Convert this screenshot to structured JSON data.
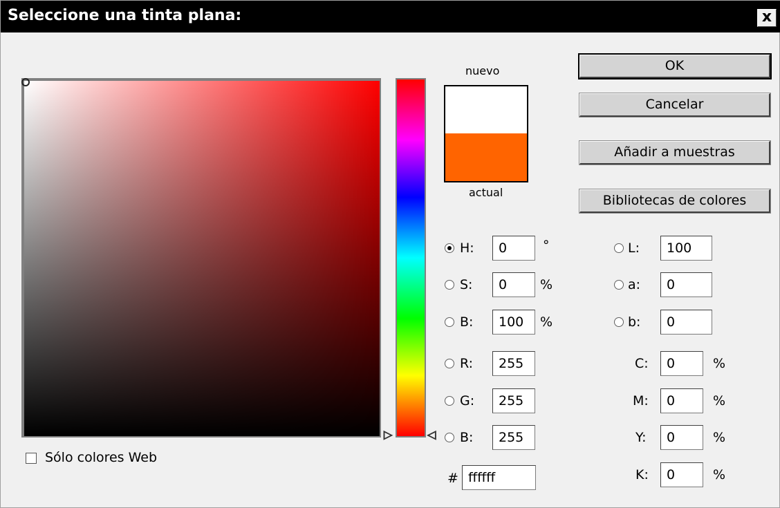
{
  "dialog": {
    "title": "Seleccione una tinta plana:",
    "close_label": "x"
  },
  "colors": {
    "nuevo": "#ffffff",
    "actual": "#ff6400",
    "hue_field_base": "#ff0000"
  },
  "swatch": {
    "new_label": "nuevo",
    "current_label": "actual"
  },
  "buttons": {
    "ok": "OK",
    "cancel": "Cancelar",
    "add_to_swatches": "Añadir a muestras",
    "color_libraries": "Bibliotecas de colores"
  },
  "hsb": {
    "h": {
      "label": "H:",
      "value": "0",
      "unit": "°",
      "selected": true
    },
    "s": {
      "label": "S:",
      "value": "0",
      "unit": "%"
    },
    "b": {
      "label": "B:",
      "value": "100",
      "unit": "%"
    }
  },
  "rgb": {
    "r": {
      "label": "R:",
      "value": "255"
    },
    "g": {
      "label": "G:",
      "value": "255"
    },
    "b": {
      "label": "B:",
      "value": "255"
    }
  },
  "lab": {
    "l": {
      "label": "L:",
      "value": "100"
    },
    "a": {
      "label": "a:",
      "value": "0"
    },
    "b": {
      "label": "b:",
      "value": "0"
    }
  },
  "cmyk": {
    "c": {
      "label": "C:",
      "value": "0",
      "unit": "%"
    },
    "m": {
      "label": "M:",
      "value": "0",
      "unit": "%"
    },
    "y": {
      "label": "Y:",
      "value": "0",
      "unit": "%"
    },
    "k": {
      "label": "K:",
      "value": "0",
      "unit": "%"
    }
  },
  "hex": {
    "label": "#",
    "value": "ffffff"
  },
  "web_only": {
    "label": "Sólo colores Web",
    "checked": false
  }
}
